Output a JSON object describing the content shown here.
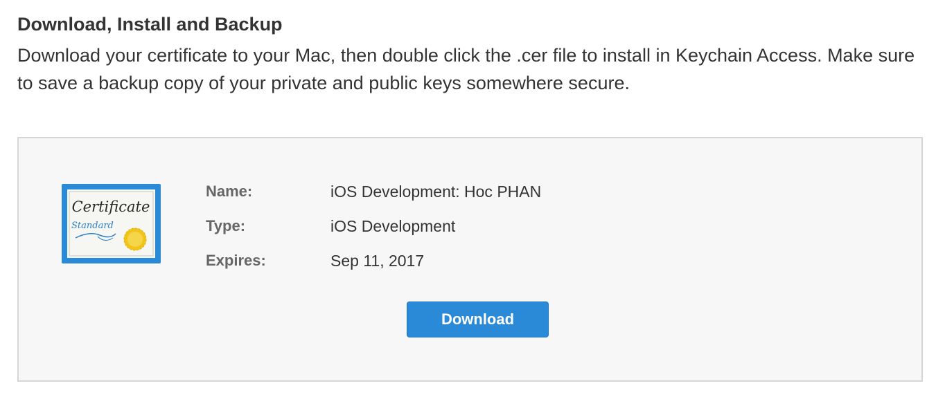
{
  "section": {
    "title": "Download, Install and Backup",
    "description": "Download your certificate to your Mac, then double click the .cer file to install in Keychain Access. Make sure to save a backup copy of your private and public keys somewhere secure."
  },
  "certificate": {
    "icon": "certificate-icon",
    "icon_text_line1": "Certificate",
    "icon_text_line2": "Standard",
    "name_label": "Name:",
    "name_value": "iOS Development: Hoc PHAN",
    "type_label": "Type:",
    "type_value": "iOS Development",
    "expires_label": "Expires:",
    "expires_value": "Sep 11, 2017"
  },
  "actions": {
    "download_label": "Download"
  },
  "colors": {
    "accent": "#2b8ad8",
    "icon_border": "#2b8ad8",
    "seal": "#f0c419",
    "panel_background": "#f7f7f7",
    "panel_border": "#d6d6d6"
  }
}
